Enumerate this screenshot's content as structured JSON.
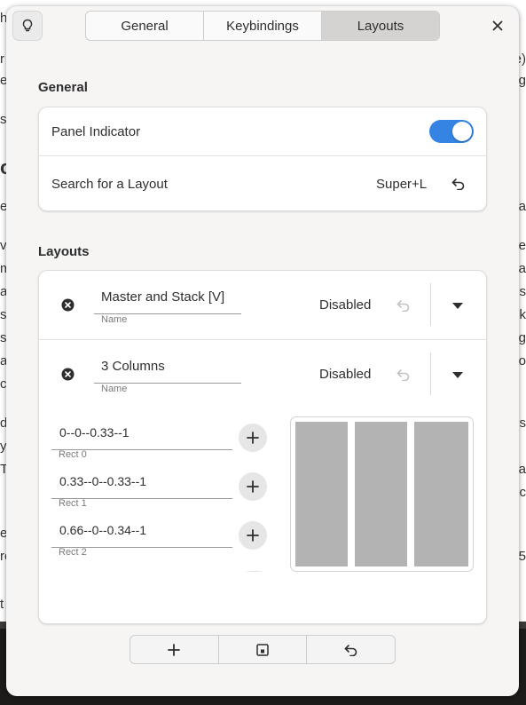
{
  "background": {
    "left_fragments": [
      "h",
      "r",
      "es",
      "",
      "s",
      "",
      "o",
      "",
      "e",
      "",
      "vo",
      "m",
      "a",
      "s",
      "s",
      "a",
      "c",
      "",
      "d",
      "y",
      "T",
      "",
      "e",
      "ro",
      "",
      "t"
    ],
    "right_fragments": [
      "",
      "e)",
      "ig",
      "",
      "",
      "",
      "",
      "",
      "ta",
      "",
      "e",
      "ba",
      "ns",
      "k",
      "ig",
      "ro",
      "",
      "",
      "s",
      "a",
      "ec",
      "",
      "",
      "5",
      ""
    ]
  },
  "header": {
    "tabs": [
      {
        "label": "General",
        "active": false
      },
      {
        "label": "Keybindings",
        "active": false
      },
      {
        "label": "Layouts",
        "active": true
      }
    ]
  },
  "general": {
    "title": "General",
    "panel_indicator": {
      "label": "Panel Indicator",
      "enabled": true
    },
    "search_layout": {
      "label": "Search for a Layout",
      "shortcut": "Super+L"
    }
  },
  "layouts": {
    "title": "Layouts",
    "items": [
      {
        "name": "Master and Stack [V]",
        "name_caption": "Name",
        "status": "Disabled"
      },
      {
        "name": "3 Columns",
        "name_caption": "Name",
        "status": "Disabled",
        "rects": [
          {
            "value": "0--0--0.33--1",
            "caption": "Rect 0"
          },
          {
            "value": "0.33--0--0.33--1",
            "caption": "Rect 1"
          },
          {
            "value": "0.66--0--0.34--1",
            "caption": "Rect 2"
          }
        ],
        "preview_columns": [
          0.33,
          0.33,
          0.34
        ]
      }
    ]
  },
  "colors": {
    "accent": "#3584e4",
    "preview_fill": "#b3b3b3"
  }
}
